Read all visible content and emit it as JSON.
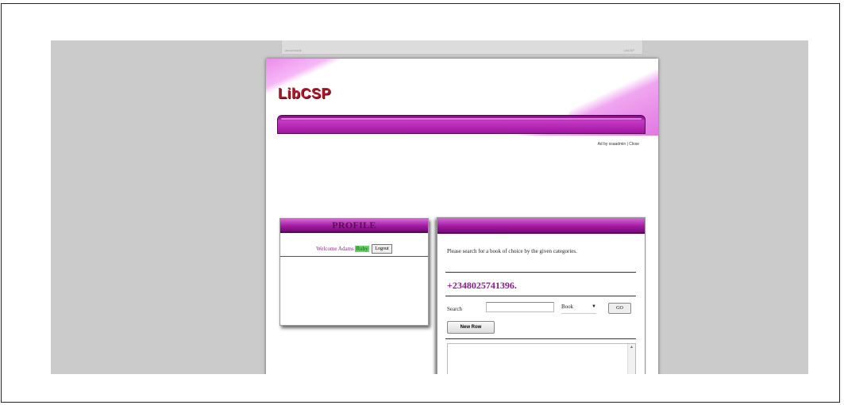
{
  "browser_top_strip": {
    "left_text": "about:blank",
    "right_text": "LibCSP"
  },
  "site": {
    "logo": "LibCSP"
  },
  "ad_line": "Ad by ssaadmin | Close",
  "profile": {
    "heading": "PROFILE",
    "welcome_text": "Welcome Adams",
    "username": "Ruby",
    "logout_label": "Logout"
  },
  "search_panel": {
    "heading": "",
    "instructions": "Please search for a book of choice by the given categories.",
    "phone": "+2348025741396.",
    "search_label": "Search",
    "search_value": "",
    "category_selected": "Book",
    "go_label": "GO",
    "new_row_label": "New Row"
  },
  "colors": {
    "accent": "#a31ca3",
    "logo": "#b0182a",
    "username_bg": "#69d269"
  }
}
